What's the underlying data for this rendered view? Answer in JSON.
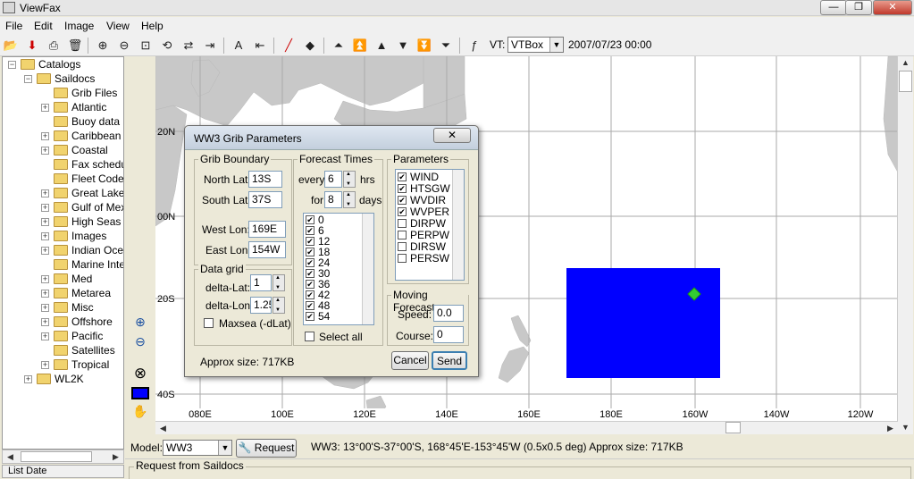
{
  "window": {
    "title": "ViewFax",
    "minimize": "—",
    "maximize": "❐",
    "close": "✕"
  },
  "menu": [
    "File",
    "Edit",
    "Image",
    "View",
    "Help"
  ],
  "toolbar": {
    "vt_label": "VT:",
    "vt_value": "VTBox",
    "datetime": "2007/07/23 00:00"
  },
  "tree": {
    "root": "Catalogs",
    "saildocs": "Saildocs",
    "children": [
      "Grib Files",
      "Atlantic",
      "Buoy data",
      "Caribbean",
      "Coastal",
      "Fax schedul",
      "Fleet Code",
      "Great Lakes",
      "Gulf of Mexic",
      "High Seas",
      "Images",
      "Indian Ocea",
      "Marine Interp",
      "Med",
      "Metarea",
      "Misc",
      "Offshore",
      "Pacific",
      "Satellites",
      "Tropical"
    ],
    "expandable": [
      false,
      true,
      false,
      true,
      true,
      false,
      false,
      true,
      true,
      true,
      true,
      true,
      false,
      true,
      true,
      true,
      true,
      true,
      false,
      true
    ],
    "last": "WL2K",
    "list_date": "List Date"
  },
  "map": {
    "lat_labels": [
      "20N",
      "00N",
      "20S",
      "40S"
    ],
    "lon_labels": [
      "080E",
      "100E",
      "120E",
      "140E",
      "160E",
      "180E",
      "160W",
      "140W",
      "120W"
    ],
    "ocean_color": "#ffffff",
    "land_color": "#c8c8c8",
    "box_color": "#0000ff",
    "marker_color": "#33cc33"
  },
  "dialog": {
    "title": "WW3 Grib Parameters",
    "close": "✕",
    "grib_boundary": {
      "label": "Grib Boundary",
      "north_label": "North Lat:",
      "north": "13S",
      "south_label": "South Lat:",
      "south": "37S",
      "west_label": "West Lon:",
      "west": "169E",
      "east_label": "East Lon:",
      "east": "154W"
    },
    "data_grid": {
      "label": "Data grid",
      "dlat_label": "delta-Lat:",
      "dlat": "1",
      "dlon_label": "delta-Lon:",
      "dlon": "1.25",
      "maxsea_label": "Maxsea (-dLat)"
    },
    "forecast": {
      "label": "Forecast Times",
      "every_label": "every",
      "every": "6",
      "hrs": "hrs",
      "for_label": "for",
      "for": "8",
      "days": "days",
      "times": [
        "0",
        "6",
        "12",
        "18",
        "24",
        "30",
        "36",
        "42",
        "48",
        "54"
      ],
      "select_all": "Select all"
    },
    "parameters": {
      "label": "Parameters",
      "items": [
        {
          "name": "WIND",
          "checked": true
        },
        {
          "name": "HTSGW",
          "checked": true
        },
        {
          "name": "WVDIR",
          "checked": true
        },
        {
          "name": "WVPER",
          "checked": true
        },
        {
          "name": "DIRPW",
          "checked": false
        },
        {
          "name": "PERPW",
          "checked": false
        },
        {
          "name": "DIRSW",
          "checked": false
        },
        {
          "name": "PERSW",
          "checked": false
        }
      ]
    },
    "moving": {
      "label": "Moving Forecast",
      "speed_label": "Speed:",
      "speed": "0.0",
      "course_label": "Course:",
      "course": "0"
    },
    "approx": "Approx size: 717KB",
    "cancel": "Cancel",
    "send": "Send"
  },
  "bottom": {
    "model_label": "Model:",
    "model": "WW3",
    "request": "Request",
    "status": "WW3: 13°00'S-37°00'S, 168°45'E-153°45'W (0.5x0.5 deg)  Approx size: 717KB",
    "request_panel": "Request from Saildocs"
  }
}
